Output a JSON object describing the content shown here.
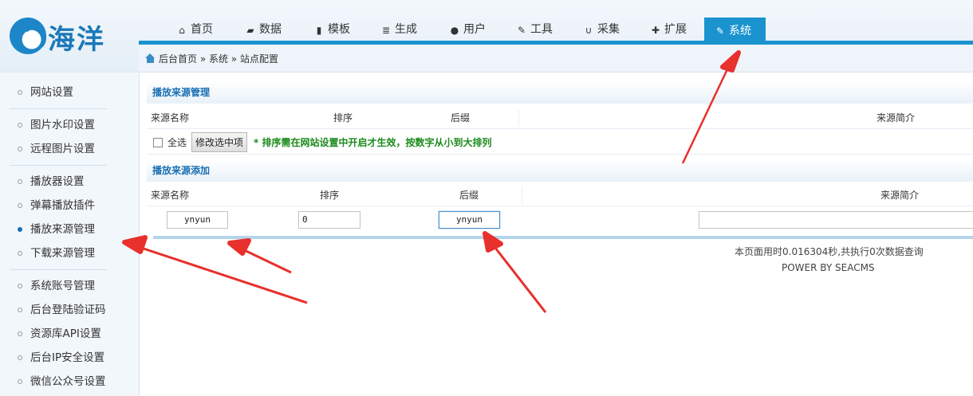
{
  "logo": {
    "text": "海洋"
  },
  "nav": {
    "items": [
      {
        "label": "首页",
        "icon": "home-icon"
      },
      {
        "label": "数据",
        "icon": "book-icon"
      },
      {
        "label": "模板",
        "icon": "file-icon"
      },
      {
        "label": "生成",
        "icon": "server-icon"
      },
      {
        "label": "用户",
        "icon": "user-icon"
      },
      {
        "label": "工具",
        "icon": "wrench-icon"
      },
      {
        "label": "采集",
        "icon": "magnet-icon"
      },
      {
        "label": "扩展",
        "icon": "puzzle-icon"
      },
      {
        "label": "系统",
        "icon": "edit-icon",
        "active": true
      }
    ]
  },
  "breadcrumb": {
    "text": "后台首页 » 系统 » 站点配置"
  },
  "sidebar": {
    "items": [
      {
        "label": "网站设置"
      },
      {
        "label": "图片水印设置"
      },
      {
        "label": "远程图片设置"
      },
      {
        "label": "播放器设置"
      },
      {
        "label": "弹幕播放插件"
      },
      {
        "label": "播放来源管理",
        "active": true
      },
      {
        "label": "下载来源管理"
      },
      {
        "label": "系统账号管理"
      },
      {
        "label": "后台登陆验证码"
      },
      {
        "label": "资源库API设置"
      },
      {
        "label": "后台IP安全设置"
      },
      {
        "label": "微信公众号设置"
      }
    ]
  },
  "manage": {
    "title": "播放来源管理",
    "col_name": "来源名称",
    "col_order": "排序",
    "col_suffix": "后缀",
    "col_desc": "来源简介",
    "select_all": "全选",
    "modify_button": "修改选中项",
    "note": "* 排序需在网站设置中开启才生效，按数字从小到大排列"
  },
  "add": {
    "title": "播放来源添加",
    "col_name": "来源名称",
    "col_order": "排序",
    "col_suffix": "后缀",
    "col_desc": "来源简介",
    "name_value": "ynyun",
    "order_value": "0",
    "suffix_value": "ynyun",
    "desc_value": ""
  },
  "footer": {
    "timing": "本页面用时0.016304秒,共执行0次数据查询",
    "powered": "POWER BY SEACMS"
  },
  "colors": {
    "accent": "#1a93cf",
    "arrow": "#e8302c"
  }
}
